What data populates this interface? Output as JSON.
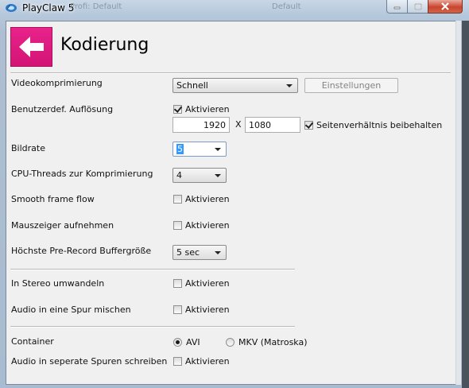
{
  "window": {
    "title": "PlayClaw 5",
    "ghost_left": "Profi: Default",
    "ghost_right": "Default",
    "minimize": "minimize",
    "maximize": "maximize",
    "close": "close"
  },
  "header": {
    "title": "Kodierung",
    "back_icon": "arrow-left-icon",
    "accent": "#e0197f"
  },
  "settings": {
    "videokompression": {
      "label": "Videokomprimierung",
      "value": "Schnell",
      "button": "Einstellungen"
    },
    "aufloesung": {
      "label": "Benutzerdef. Auflösung",
      "checkbox": "Aktivieren",
      "checked": true,
      "width": "1920",
      "separator": "X",
      "height": "1080",
      "aspect_label": "Seitenverhältnis beibehalten",
      "aspect_checked": true
    },
    "bildrate": {
      "label": "Bildrate",
      "value": "5"
    },
    "threads": {
      "label": "CPU-Threads zur Komprimierung",
      "value": "4"
    },
    "smooth": {
      "label": "Smooth frame flow",
      "checkbox": "Aktivieren",
      "checked": false
    },
    "mauszeiger": {
      "label": "Mauszeiger aufnehmen",
      "checkbox": "Aktivieren",
      "checked": false
    },
    "prerecord": {
      "label": "Höchste Pre-Record Buffergröße",
      "value": "5 sec"
    },
    "stereo": {
      "label": "In Stereo umwandeln",
      "checkbox": "Aktivieren",
      "checked": false
    },
    "audiomix": {
      "label": "Audio in eine Spur mischen",
      "checkbox": "Aktivieren",
      "checked": false
    },
    "container": {
      "label": "Container",
      "options": [
        "AVI",
        "MKV (Matroska)"
      ],
      "selected": "AVI"
    },
    "separate_tracks": {
      "label": "Audio in seperate Spuren schreiben",
      "checkbox": "Aktivieren",
      "checked": false
    }
  }
}
